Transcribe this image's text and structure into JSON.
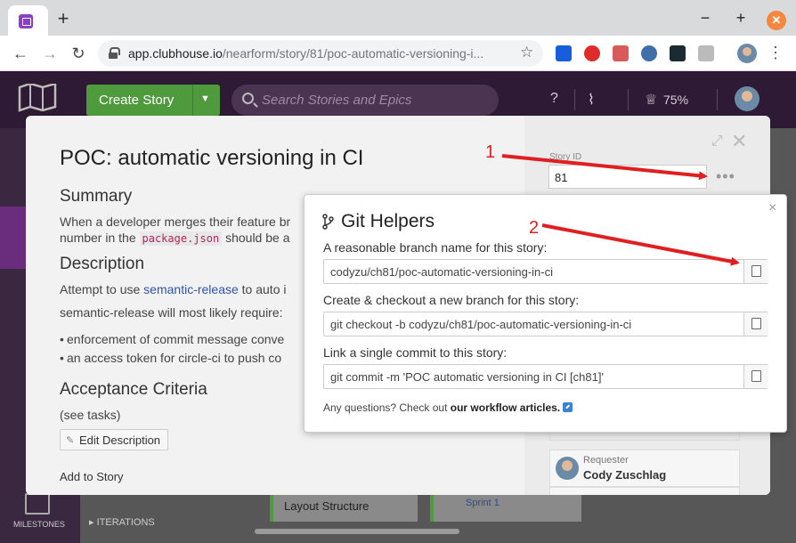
{
  "browser": {
    "new_tab": "+",
    "minimize": "−",
    "maximize": "+",
    "close": "✕",
    "url_host": "app.clubhouse.io",
    "url_path": "/nearform/story/81/poc-automatic-versioning-i...",
    "extensions": [
      {
        "name": "bitwarden-icon",
        "color": "#175ddc"
      },
      {
        "name": "adblock-icon",
        "color": "#e02b2b"
      },
      {
        "name": "gist-icon",
        "color": "#d95a5a"
      },
      {
        "name": "password-icon",
        "color": "#3f6ea8"
      },
      {
        "name": "react-devtools-icon",
        "color": "#1a2b34"
      },
      {
        "name": "extension-icon",
        "color": "#777777"
      }
    ]
  },
  "app": {
    "create_story": "Create Story",
    "search_placeholder": "Search Stories and Epics",
    "progress": "75%",
    "nav_bottom": "MILESTONES",
    "iterations": "ITERATIONS",
    "bg_cards": [
      "Layout Structure",
      "Sprint 1"
    ]
  },
  "story": {
    "title": "POC: automatic versioning in CI",
    "summary_heading": "Summary",
    "summary_line1": "When a developer merges their feature br",
    "summary_line2_pre": "number in the ",
    "summary_code": "package.json",
    "summary_line2_post": " should be a",
    "description_heading": "Description",
    "desc_pre": "Attempt to use ",
    "desc_link": "semantic-release",
    "desc_post": " to auto i",
    "desc_line2": "semantic-release will most likely require:",
    "bullets": [
      "enforcement of commit message conve",
      "an access token for circle-ci to push co"
    ],
    "acceptance_heading": "Acceptance Criteria",
    "acceptance_text": "(see tasks)",
    "edit_description": "Edit Description",
    "add_to_story": "Add to Story",
    "story_id_label": "Story ID",
    "story_id": "81",
    "more": "•••",
    "requester_label": "Requester",
    "requester_name": "Cody Zuschlag"
  },
  "git_helpers": {
    "title": "Git Helpers",
    "close": "×",
    "branch_label": "A reasonable branch name for this story:",
    "branch_value": "codyzu/ch81/poc-automatic-versioning-in-ci",
    "checkout_label": "Create & checkout a new branch for this story:",
    "checkout_value": "git checkout -b codyzu/ch81/poc-automatic-versioning-in-ci",
    "commit_label": "Link a single commit to this story:",
    "commit_value": "git commit -m 'POC automatic versioning in CI [ch81]'",
    "footer_pre": "Any questions? Check out ",
    "footer_link": "our workflow articles."
  },
  "annotations": [
    "1",
    "2"
  ],
  "colors": {
    "accent_purple": "#2f1a35",
    "create_green": "#4f9a3c",
    "annotation_red": "#e02020",
    "link_blue": "#2a55b0"
  }
}
